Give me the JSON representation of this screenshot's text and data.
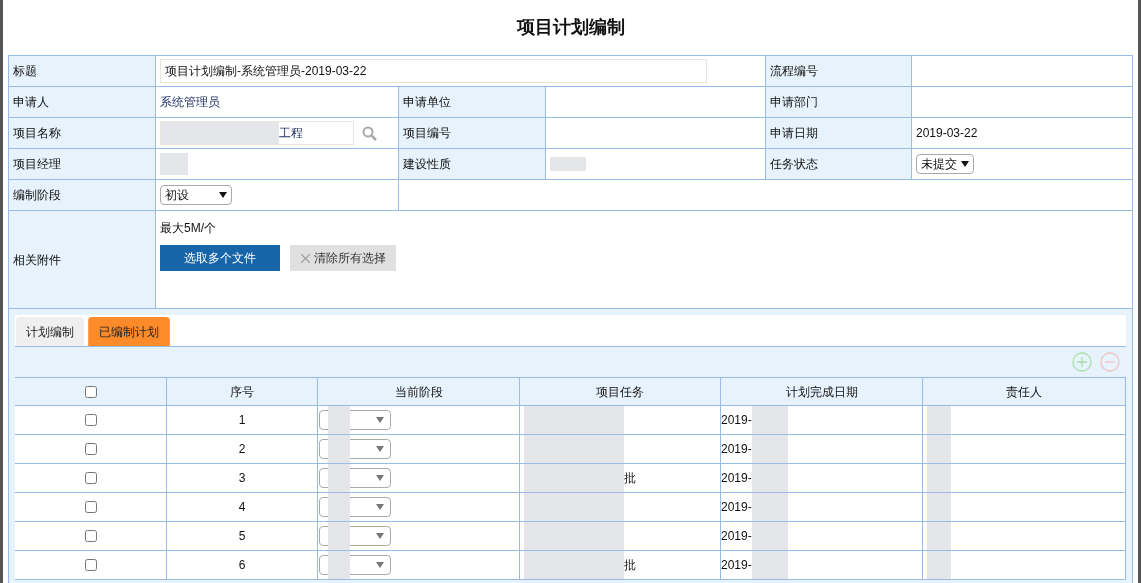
{
  "page_title": "项目计划编制",
  "form": {
    "title_label": "标题",
    "title_value": "项目计划编制-系统管理员-2019-03-22",
    "flow_label": "流程编号",
    "applicant_label": "申请人",
    "applicant_value": "系统管理员",
    "unit_label": "申请单位",
    "dept_label": "申请部门",
    "project_name_label": "项目名称",
    "project_name_value": "工程",
    "project_no_label": "项目编号",
    "date_label": "申请日期",
    "date_value": "2019-03-22",
    "manager_label": "项目经理",
    "nature_label": "建设性质",
    "status_label": "任务状态",
    "status_value": "未提交",
    "stage_label": "编制阶段",
    "stage_value": "初设",
    "attach_label": "相关附件",
    "attach_hint": "最大5M/个",
    "pick_button": "选取多个文件",
    "clear_button": "清除所有选择"
  },
  "tabs": [
    {
      "label": "计划编制",
      "selected": false
    },
    {
      "label": "已编制计划",
      "selected": true
    }
  ],
  "table": {
    "select_all_checked": false,
    "columns": [
      "序号",
      "当前阶段",
      "项目任务",
      "计划完成日期",
      "责任人"
    ],
    "rows": [
      {
        "checked": false,
        "no": "1",
        "date": "2019-"
      },
      {
        "checked": false,
        "no": "2",
        "date": "2019-"
      },
      {
        "checked": false,
        "no": "3",
        "task": "批",
        "date": "2019-"
      },
      {
        "checked": false,
        "no": "4",
        "date": "2019-"
      },
      {
        "checked": false,
        "no": "5",
        "date": "2019-"
      },
      {
        "checked": false,
        "no": "6",
        "task": "批",
        "date": "2019-"
      }
    ]
  }
}
